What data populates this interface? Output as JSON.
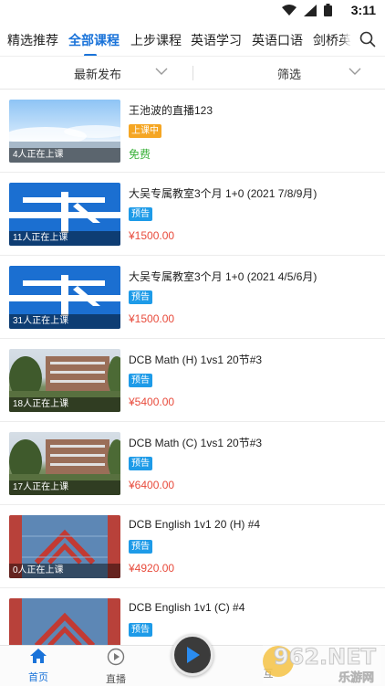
{
  "status_bar": {
    "time": "3:11"
  },
  "tabs": [
    {
      "label": "精选推荐"
    },
    {
      "label": "全部课程"
    },
    {
      "label": "上步课程"
    },
    {
      "label": "英语学习"
    },
    {
      "label": "英语口语"
    },
    {
      "label": "剑桥英语"
    }
  ],
  "active_tab_index": 1,
  "filters": {
    "left": "最新发布",
    "right": "筛选"
  },
  "courses": [
    {
      "title": "王池波的直播123",
      "badge": "上课中",
      "badge_kind": "live",
      "price": "免费",
      "students": "4人正在上课"
    },
    {
      "title": "大吴专属教室3个月 1+0 (2021 7/8/9月)",
      "badge": "预告",
      "badge_kind": "preview",
      "price": "¥1500.00",
      "students": "11人正在上课"
    },
    {
      "title": "大吴专属教室3个月 1+0 (2021 4/5/6月)",
      "badge": "预告",
      "badge_kind": "preview",
      "price": "¥1500.00",
      "students": "31人正在上课"
    },
    {
      "title": "DCB Math (H) 1vs1 20节#3",
      "badge": "预告",
      "badge_kind": "preview",
      "price": "¥5400.00",
      "students": "18人正在上课"
    },
    {
      "title": "DCB Math (C) 1vs1 20节#3",
      "badge": "预告",
      "badge_kind": "preview",
      "price": "¥6400.00",
      "students": "17人正在上课"
    },
    {
      "title": "DCB English 1v1 20  (H) #4",
      "badge": "预告",
      "badge_kind": "preview",
      "price": "¥4920.00",
      "students": "0人正在上课"
    },
    {
      "title": "DCB English 1v1 (C) #4",
      "badge": "预告",
      "badge_kind": "preview",
      "price": "",
      "students": ""
    }
  ],
  "bottom_nav": {
    "home": "首页",
    "live": "直播",
    "partial": "互"
  },
  "watermark": {
    "brand": "962.NET",
    "sub": "乐游网"
  },
  "colors": {
    "accent": "#1a73d9",
    "price": "#e84b3c",
    "free": "#3bb23b",
    "live_badge": "#f5a623",
    "preview_badge": "#1e9be8"
  }
}
